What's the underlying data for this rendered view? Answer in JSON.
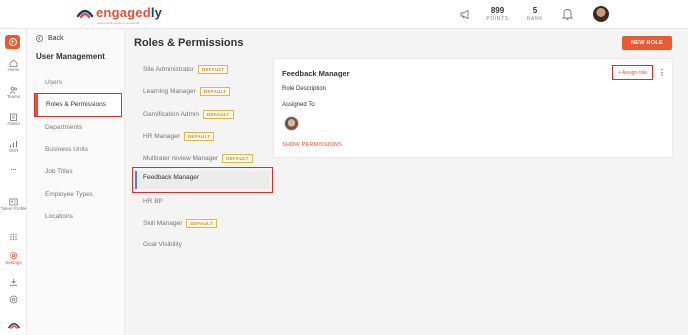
{
  "brand": {
    "name_a": "engaged",
    "name_b": "ly",
    "tagline": "where work becomes wonderful"
  },
  "topbar": {
    "points_value": "899",
    "points_label": "POINTS",
    "rank_value": "5",
    "rank_label": "RANK"
  },
  "rail": {
    "items": [
      {
        "label": "Home",
        "icon": "home-icon"
      },
      {
        "label": "Teams",
        "icon": "people-icon"
      },
      {
        "label": "Admin",
        "icon": "building-icon"
      },
      {
        "label": "OKR",
        "icon": "chart-icon"
      },
      {
        "label": "...",
        "icon": "more-icon"
      },
      {
        "label": "Talent Profile",
        "icon": "profile-card-icon"
      },
      {
        "label": "",
        "icon": "grid-icon"
      },
      {
        "label": "Settings",
        "icon": "gear-icon"
      },
      {
        "label": "",
        "icon": "download-icon"
      },
      {
        "label": "",
        "icon": "help-icon"
      }
    ]
  },
  "subnav": {
    "back_label": "Back",
    "title": "User Management",
    "items": [
      "Users",
      "Roles & Permissions",
      "Departments",
      "Business Units",
      "Job Titles",
      "Employee Types",
      "Locations"
    ]
  },
  "main": {
    "title": "Roles & Permissions",
    "new_role_label": "NEW ROLE",
    "default_badge": "DEFAULT",
    "roles": [
      {
        "name": "Site Administrator",
        "default": true
      },
      {
        "name": "Learning Manager",
        "default": true
      },
      {
        "name": "Gamification Admin",
        "default": true
      },
      {
        "name": "HR Manager",
        "default": true
      },
      {
        "name": "Multirater review Manager",
        "default": true
      },
      {
        "name": "Feedback Manager",
        "default": false,
        "selected": true
      },
      {
        "name": "HR BP",
        "default": false
      },
      {
        "name": "Skill Manager",
        "default": true
      },
      {
        "name": "Goal Visibility",
        "default": false
      }
    ]
  },
  "card": {
    "title": "Feedback Manager",
    "assign_label": "+ Assign role",
    "kebab": "⋮",
    "role_description_label": "Role Description",
    "assigned_to_label": "Assigned To",
    "show_permissions_label": "SHOW PERMISSIONS"
  },
  "colors": {
    "accent": "#ee5a2f",
    "highlight": "#d9302f",
    "badge": "#e0b84a"
  }
}
